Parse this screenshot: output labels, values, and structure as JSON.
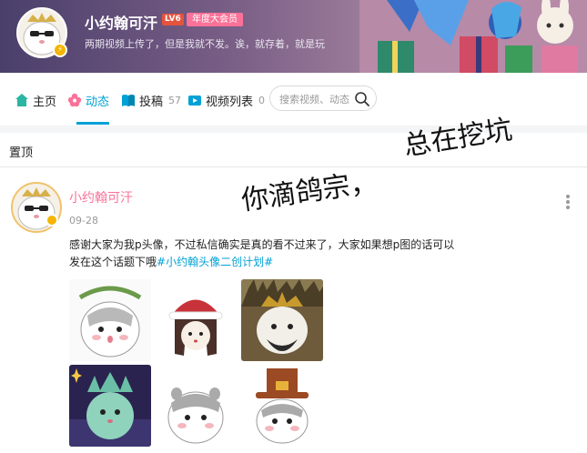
{
  "profile": {
    "username": "小约翰可汗",
    "level": "LV6",
    "vip_label": "年度大会员",
    "sign": "两期视频上传了，但是我就不发。诶，就存着，就是玩"
  },
  "nav": {
    "items": [
      {
        "label": "主页",
        "count": ""
      },
      {
        "label": "动态",
        "count": ""
      },
      {
        "label": "投稿",
        "count": "57"
      },
      {
        "label": "视频列表",
        "count": "0"
      }
    ]
  },
  "search": {
    "placeholder": "搜索视频、动态"
  },
  "pinned_label": "置顶",
  "post": {
    "author": "小约翰可汗",
    "date": "09-28",
    "text_line1": "感谢大家为我p头像，不过私信确实是真的看不过来了，大家如果想p图的话可以",
    "text_line2_prefix": "发在这个话题下哦",
    "tag": "#小约翰头像二创计划#"
  },
  "overlay": {
    "line1": "你滴鸽宗，",
    "line2": "总在挖坑"
  },
  "colors": {
    "accent_blue": "#00a1d6",
    "pink": "#fb7299",
    "level_red": "#e5533d"
  }
}
